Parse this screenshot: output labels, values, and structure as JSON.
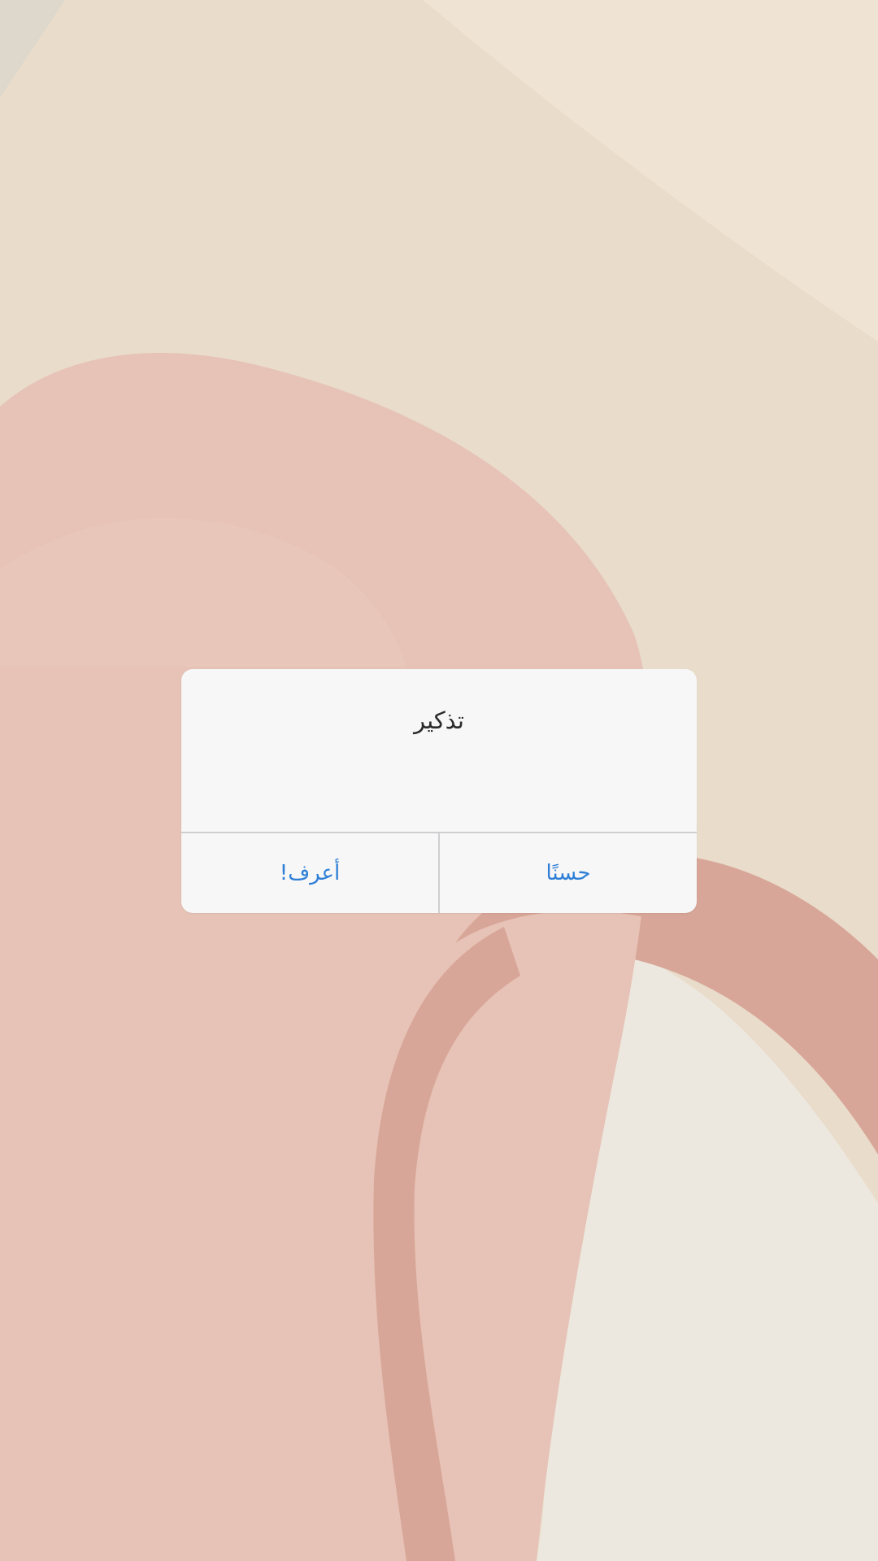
{
  "background": {
    "name": "abstract-brush-wallpaper",
    "colors": {
      "cream": "#e9dccb",
      "light_cream": "#efe7dc",
      "pink": "#e6c3b6",
      "rose": "#d8a698",
      "paper": "#efebe3"
    }
  },
  "dialog": {
    "title": "تذكير",
    "buttons": {
      "left_label": "أعرف!",
      "right_label": "حسنًا"
    },
    "accent_color": "#2f7fd6"
  }
}
